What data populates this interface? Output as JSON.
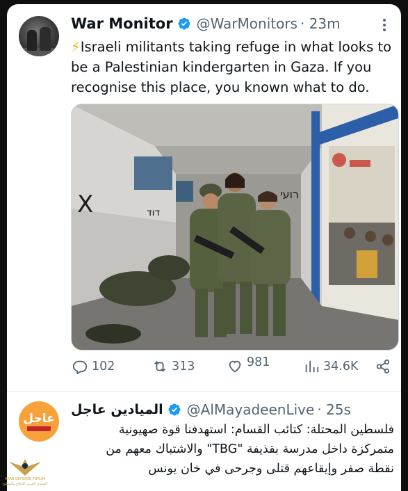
{
  "tweet1": {
    "name": "War Monitor",
    "handle": "@WarMonitors",
    "time": "· 23m",
    "emoji": "⚡",
    "text": "Israeli militants taking refuge in what looks to be a Palestinian kindergarten in Gaza. If you recognise this place, you known what to do.",
    "stats": {
      "replies": "102",
      "reposts": "313",
      "likes": "981",
      "views": "34.6K"
    }
  },
  "tweet2": {
    "name": "الميادين عاجل",
    "handle": "@AlMayadeenLive",
    "time": "· 25s",
    "avatar_text": "عاجل",
    "text_lines": [
      "فلسطين المحتلة: كتائب القسام: استهدفنا قوة صهيونية",
      "متمركزة داخل مدرسة بقذيفة \"TBG\" والاشتباك معهم من",
      "نقطة صفر وإيقاعهم قتلى وجرحى في خان يونس"
    ]
  },
  "watermark": {
    "line1": "ARAB DEFENSE FORUM",
    "line2": "المنتدى العربي للدفاع والتسليح"
  },
  "colors": {
    "verified": "#1d9bf0",
    "text": "#0f1419",
    "muted": "#536471",
    "accent_orange": "#f7a13a"
  },
  "icons": [
    "verified-badge-icon",
    "more-icon",
    "reply-icon",
    "repost-icon",
    "like-icon",
    "views-icon",
    "share-icon"
  ]
}
